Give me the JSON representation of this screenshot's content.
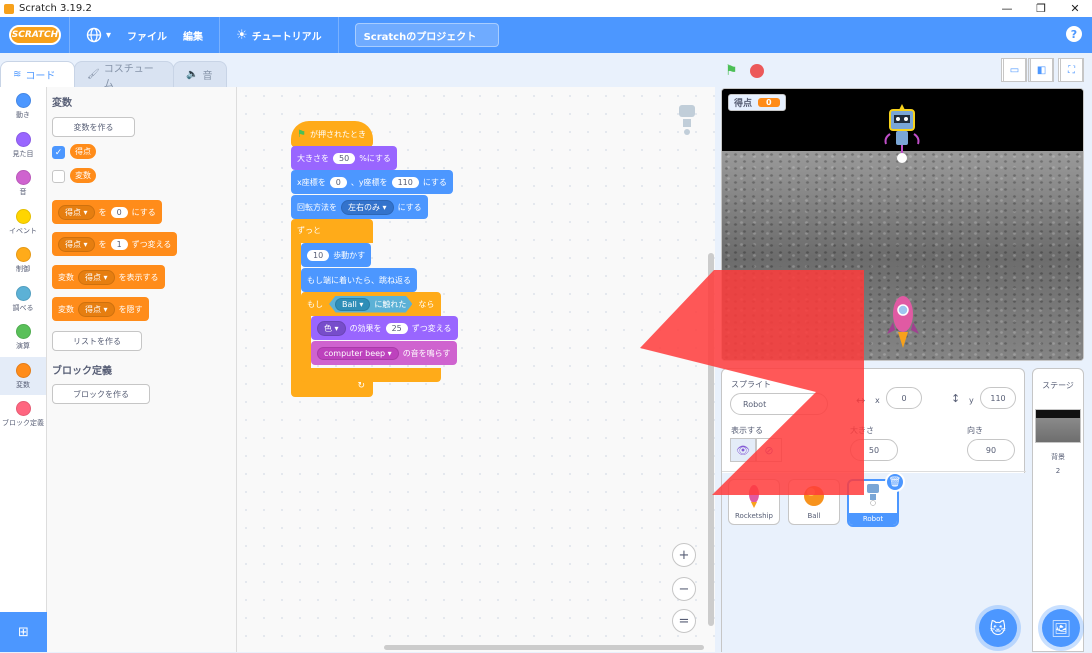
{
  "window": {
    "title": "Scratch 3.19.2"
  },
  "menubar": {
    "logo": "SCRATCH",
    "file": "ファイル",
    "edit": "編集",
    "tutorial": "チュートリアル",
    "project_title": "Scratchのプロジェクト",
    "help": "?"
  },
  "tabs": [
    {
      "label": "コード"
    },
    {
      "label": "コスチューム"
    },
    {
      "label": "音"
    }
  ],
  "categories": [
    {
      "label": "動き",
      "color": "#4c97ff"
    },
    {
      "label": "見た目",
      "color": "#9966ff"
    },
    {
      "label": "音",
      "color": "#cf63cf"
    },
    {
      "label": "イベント",
      "color": "#ffd500"
    },
    {
      "label": "制御",
      "color": "#ffab19"
    },
    {
      "label": "調べる",
      "color": "#5cb1d6"
    },
    {
      "label": "演算",
      "color": "#59c059"
    },
    {
      "label": "変数",
      "color": "#ff8c1a"
    },
    {
      "label": "ブロック定義",
      "color": "#ff6680"
    }
  ],
  "palette": {
    "heading_vars": "変数",
    "make_var": "変数を作る",
    "var_score": "得点",
    "var_var": "変数",
    "set_block": {
      "dropdown": "得点",
      "to": "を",
      "value": "0",
      "suffix": "にする"
    },
    "change_block": {
      "dropdown": "得点",
      "by": "を",
      "value": "1",
      "suffix": "ずつ変える"
    },
    "show_block": {
      "prefix": "変数",
      "dropdown": "得点",
      "suffix": "を表示する"
    },
    "hide_block": {
      "prefix": "変数",
      "dropdown": "得点",
      "suffix": "を隠す"
    },
    "make_list": "リストを作る",
    "heading_myblocks": "ブロック定義",
    "make_block": "ブロックを作る"
  },
  "script": {
    "hat": "が押されたとき",
    "size_prefix": "大きさを",
    "size_value": "50",
    "size_suffix": "%にする",
    "goto_x_label": "x座標を",
    "goto_x_value": "0",
    "goto_y_label": "、y座標を",
    "goto_y_value": "110",
    "goto_suffix": "にする",
    "rotation_label": "回転方法を",
    "rotation_value": "左右のみ",
    "rotation_suffix": "にする",
    "forever": "ずっと",
    "move_value": "10",
    "move_suffix": "歩動かす",
    "bounce": "もし端に着いたら、跳ね返る",
    "if_label": "もし",
    "touch_target": "Ball",
    "touch_suffix": "に触れた",
    "then": "なら",
    "effect_dropdown": "色",
    "effect_label": "の効果を",
    "effect_value": "25",
    "effect_suffix": "ずつ変える",
    "sound_dropdown": "computer beep",
    "sound_suffix": "の音を鳴らす"
  },
  "zoom": {
    "in": "+",
    "out": "−",
    "reset": "="
  },
  "stage": {
    "monitor_label": "得点",
    "monitor_value": "0"
  },
  "sprite_info": {
    "sprite_label": "スプライト",
    "sprite_name": "Robot",
    "x_label": "x",
    "x_value": "0",
    "y_label": "y",
    "y_value": "110",
    "show_label": "表示する",
    "size_label": "大きさ",
    "size_value": "50",
    "direction_label": "向き",
    "direction_value": "90"
  },
  "sprites": [
    {
      "name": "Rocketship"
    },
    {
      "name": "Ball"
    },
    {
      "name": "Robot"
    }
  ],
  "stage_pane": {
    "title": "ステージ",
    "backdrops_label": "背景",
    "backdrops_count": "2"
  }
}
